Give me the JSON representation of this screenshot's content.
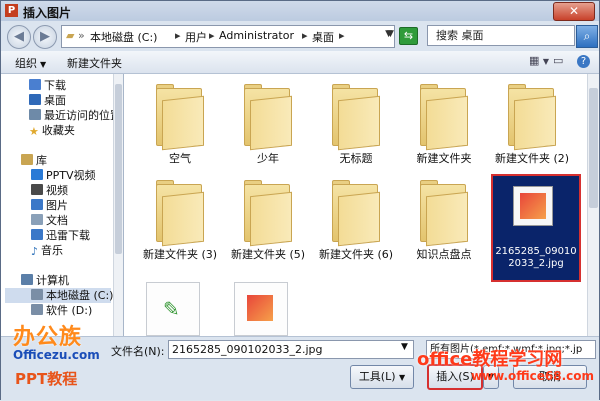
{
  "window": {
    "title": "插入图片",
    "app_icon": "P"
  },
  "address": {
    "segments": [
      "本地磁盘 (C:)",
      "用户",
      "Administrator",
      "桌面"
    ]
  },
  "search": {
    "placeholder": "搜索 桌面"
  },
  "toolbar": {
    "organize": "组织",
    "new_folder": "新建文件夹"
  },
  "sidebar": {
    "items": [
      {
        "label": "下载",
        "icon": "download-folder-icon",
        "color": "#4a7fd0"
      },
      {
        "label": "桌面",
        "icon": "desktop-icon",
        "color": "#2f69b8"
      },
      {
        "label": "最近访问的位置",
        "icon": "recent-places-icon",
        "color": "#6e8aa8"
      },
      {
        "label": "收藏夹",
        "icon": "favorites-star-icon",
        "color": "#e0a92d"
      },
      {
        "label": "库",
        "icon": "library-icon",
        "color": "#c9a552"
      },
      {
        "label": "PPTV视频",
        "icon": "pptv-icon",
        "color": "#2a7ad6"
      },
      {
        "label": "视频",
        "icon": "video-icon",
        "color": "#4a4a4a"
      },
      {
        "label": "图片",
        "icon": "pictures-icon",
        "color": "#3b78c8"
      },
      {
        "label": "文档",
        "icon": "documents-icon",
        "color": "#8aa0b8"
      },
      {
        "label": "迅雷下载",
        "icon": "thunder-download-icon",
        "color": "#3b78c8"
      },
      {
        "label": "音乐",
        "icon": "music-icon",
        "color": "#2a6fb8"
      },
      {
        "label": "计算机",
        "icon": "computer-icon",
        "color": "#5b7fa8"
      },
      {
        "label": "本地磁盘 (C:)",
        "icon": "disk-icon",
        "color": "#7a8ea6"
      },
      {
        "label": "软件 (D:)",
        "icon": "disk-icon",
        "color": "#7a8ea6"
      }
    ]
  },
  "files": {
    "folders": [
      "空气",
      "少年",
      "无标题",
      "新建文件夹",
      "新建文件夹 (2)",
      "新建文件夹 (3)",
      "新建文件夹 (5)",
      "新建文件夹 (6)",
      "知识点盘点"
    ],
    "selected_file": "2165285_090102033_2.jpg"
  },
  "bottom": {
    "filename_label": "文件名(N):",
    "filename_value": "2165285_090102033_2.jpg",
    "filetype_value": "所有图片(*.emf;*.wmf;*.jpg;*.jp",
    "tools_label": "工具(L)",
    "insert_label": "插入(S)",
    "cancel_label": "取消"
  },
  "watermark": {
    "logo": "办公族",
    "url": "Officezu.com",
    "ppt": "PPT教程",
    "site_cn": "office教程学习网",
    "site_url": "www.office68.com"
  }
}
